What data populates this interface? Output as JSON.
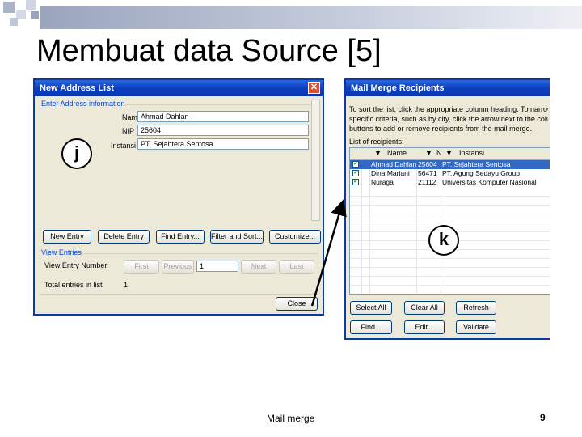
{
  "slide": {
    "title": "Membuat data Source [5]",
    "footer": "Mail merge",
    "page_number": "9"
  },
  "address_dialog": {
    "title": "New Address List",
    "close_glyph": "✕",
    "group_enter": "Enter Address information",
    "fields": [
      {
        "label": "Nama",
        "value": "Ahmad Dahlan"
      },
      {
        "label": "NIP",
        "value": "25604"
      },
      {
        "label": "Instansi",
        "value": "PT. Sejahtera Sentosa"
      }
    ],
    "buttons": {
      "new_entry": "New Entry",
      "delete_entry": "Delete Entry",
      "find_entry": "Find Entry...",
      "filter_sort": "Filter and Sort...",
      "customize": "Customize..."
    },
    "group_view": "View Entries",
    "view_entry_label": "View Entry Number",
    "nav": {
      "first": "First",
      "previous": "Previous",
      "entry_number": "1",
      "next": "Next",
      "last": "Last"
    },
    "total_label": "Total entries in list",
    "total_value": "1",
    "close_button": "Close"
  },
  "recipients_dialog": {
    "title": "Mail Merge Recipients",
    "instructions": [
      "To sort the list, click the appropriate column heading. To narrow dow",
      "specific criteria, such as by city, click the arrow next to the column hea",
      "buttons to add or remove recipients from the mail merge."
    ],
    "list_label": "List of recipients:",
    "columns": [
      "Name",
      "N",
      "Instansi"
    ],
    "rows": [
      {
        "name": "Ahmad Dahlan",
        "nip": "25604",
        "instansi": "PT. Sejahtera Sentosa",
        "checked": true,
        "selected": true
      },
      {
        "name": "Dina Mariani",
        "nip": "56471",
        "instansi": "PT. Agung Sedayu Group",
        "checked": true,
        "selected": false
      },
      {
        "name": "Nuraga",
        "nip": "21112",
        "instansi": "Universitas Komputer Nasional",
        "checked": true,
        "selected": false
      }
    ],
    "buttons": {
      "select_all": "Select All",
      "clear_all": "Clear All",
      "refresh": "Refresh",
      "find": "Find...",
      "edit": "Edit...",
      "validate": "Validate"
    }
  },
  "callouts": {
    "j": "j",
    "k": "k"
  }
}
